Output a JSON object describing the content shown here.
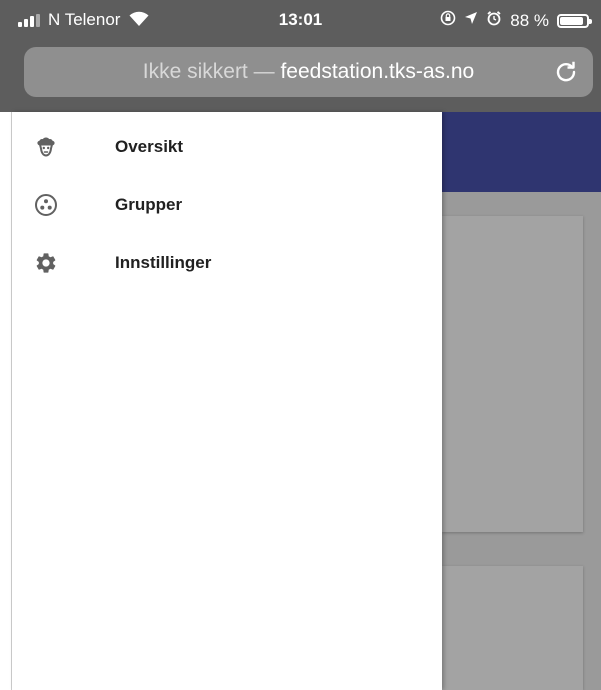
{
  "status_bar": {
    "carrier": "N Telenor",
    "time": "13:01",
    "battery_percent": "88 %",
    "battery_level": 0.88,
    "icons": [
      "signal-icon",
      "wifi-icon",
      "orientation-lock-icon",
      "location-icon",
      "alarm-icon",
      "battery-icon"
    ]
  },
  "browser": {
    "insecure_label": "Ikke sikkert —",
    "domain": "feedstation.tks-as.no",
    "reload_icon": "reload-icon"
  },
  "drawer": {
    "items": [
      {
        "label": "Oversikt",
        "icon": "sheep-icon"
      },
      {
        "label": "Grupper",
        "icon": "group-icon"
      },
      {
        "label": "Innstillinger",
        "icon": "gear-icon"
      }
    ]
  },
  "colors": {
    "app_header": "#2f3570",
    "drawer_bg": "#ffffff",
    "icon_color": "#616161"
  }
}
